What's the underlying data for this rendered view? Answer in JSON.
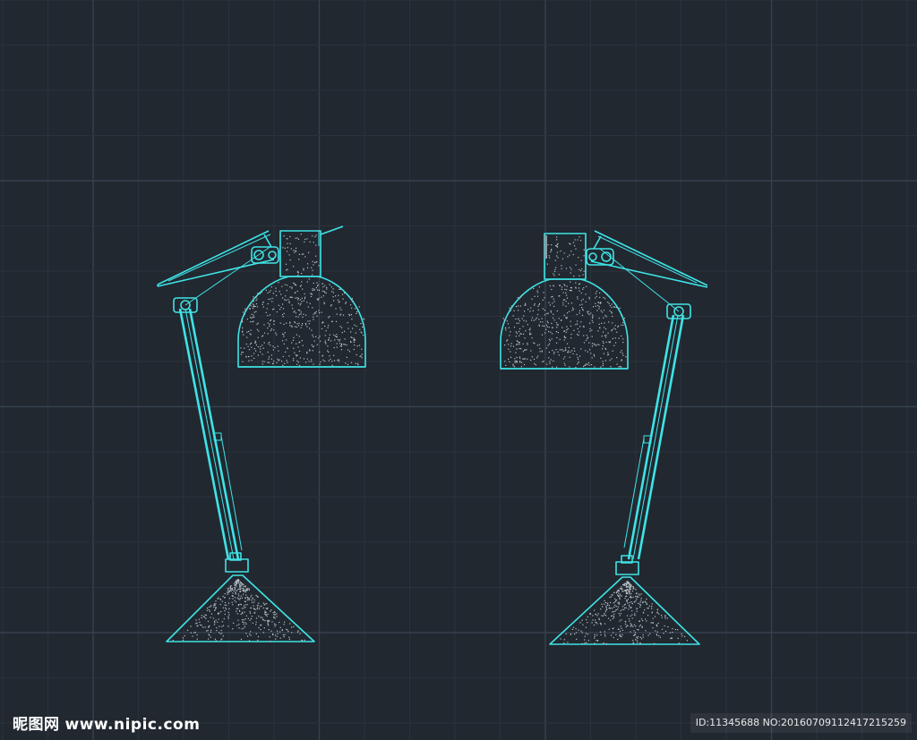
{
  "watermark": {
    "brand": "昵图网",
    "site": "www.nipic.com",
    "id_text": "ID:11345688 NO:20160709112417215259"
  },
  "colors": {
    "background": "#212830",
    "grid_minor": "#2a323c",
    "grid_major": "#37414d",
    "lamp_line": "#3fe3e6",
    "fill_dots": "#b9c3c9"
  },
  "drawing": {
    "left_lamp": "desk-lamp-facing-right",
    "right_lamp": "desk-lamp-facing-left"
  }
}
